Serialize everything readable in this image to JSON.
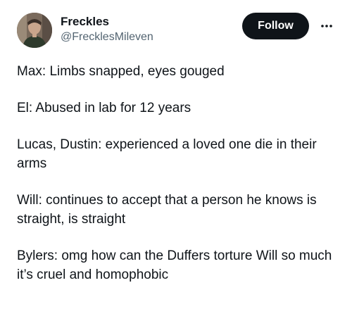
{
  "author": {
    "display_name": "Freckles",
    "handle": "@FrecklesMileven",
    "avatar_icon": "profile-photo"
  },
  "actions": {
    "follow_label": "Follow",
    "more_icon": "ellipsis-icon"
  },
  "tweet": {
    "paragraphs": [
      "Max: Limbs snapped, eyes gouged",
      "El: Abused in lab for 12 years",
      "Lucas, Dustin: experienced a loved one die in their arms",
      "Will: continues to accept that a person he knows is straight, is straight",
      "Bylers: omg how can the Duffers torture Will so much it’s cruel and homophobic"
    ]
  },
  "colors": {
    "text": "#0f1419",
    "secondary_text": "#536471",
    "follow_bg": "#0f1419",
    "follow_text": "#ffffff"
  }
}
